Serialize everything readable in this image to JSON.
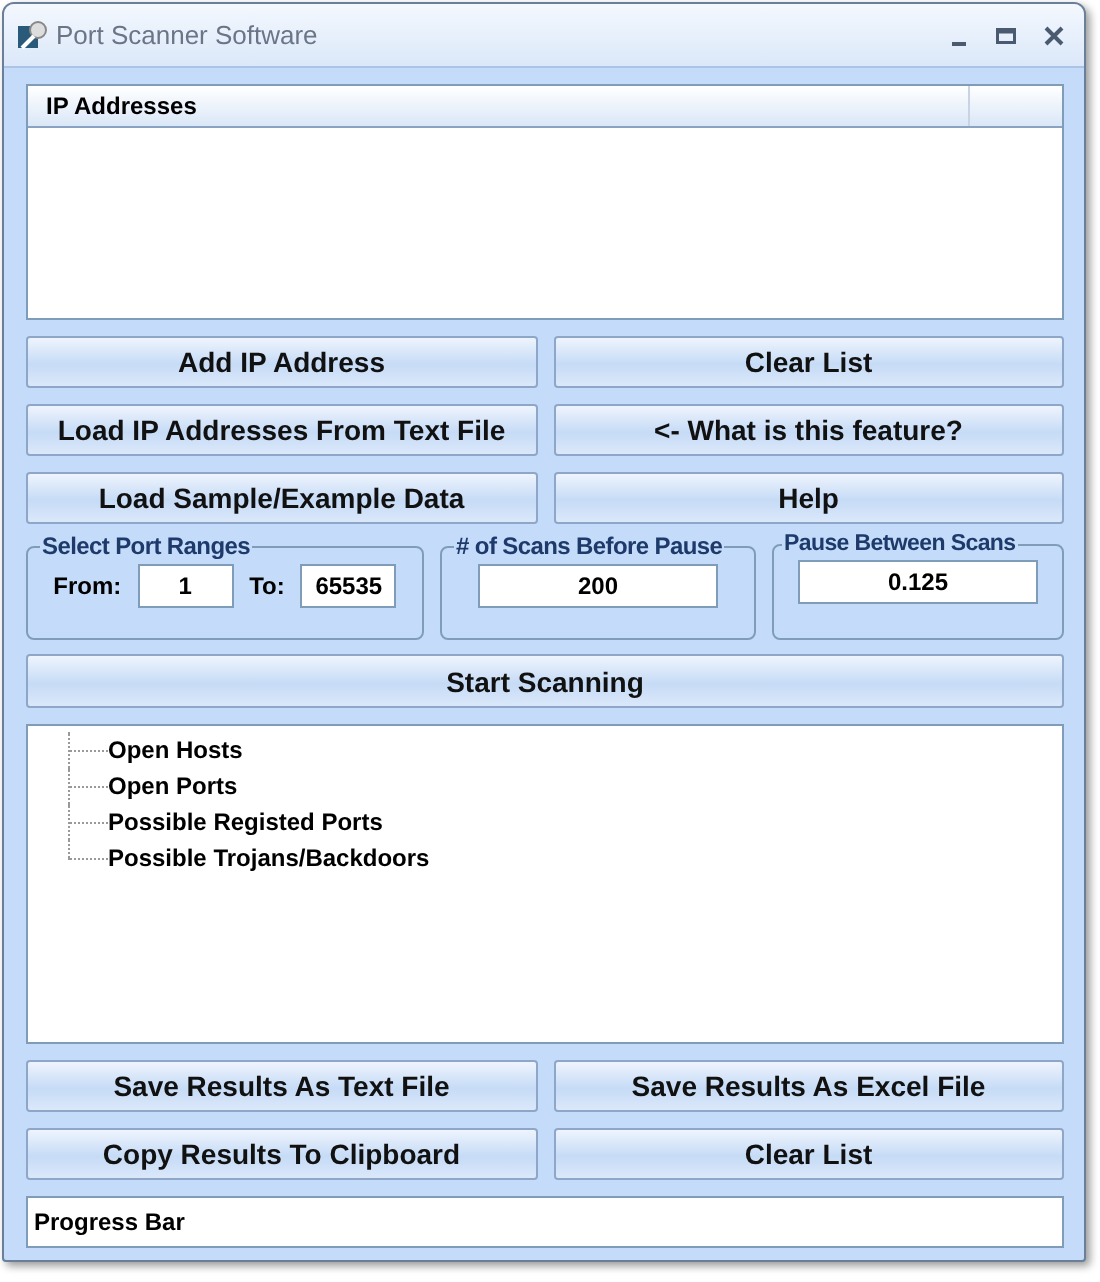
{
  "window": {
    "title": "Port Scanner Software"
  },
  "ip_list": {
    "columns": [
      "IP Addresses"
    ]
  },
  "top_buttons": [
    "Add IP Address",
    "Clear List",
    "Load IP Addresses From Text File",
    "<- What is this feature?",
    "Load Sample/Example Data",
    "Help"
  ],
  "port_ranges": {
    "title": "Select Port Ranges",
    "from_label": "From:",
    "from_value": "1",
    "to_label": "To:",
    "to_value": "65535"
  },
  "scans_before_pause": {
    "title": "# of Scans Before Pause",
    "value": "200"
  },
  "pause_between_scans": {
    "title": "Pause Between Scans",
    "value": "0.125"
  },
  "start_button": "Start Scanning",
  "results_tree": {
    "items": [
      {
        "label": "Open Hosts"
      },
      {
        "label": "Open Ports"
      },
      {
        "label": "Possible Registed Ports"
      },
      {
        "label": "Possible Trojans/Backdoors"
      }
    ]
  },
  "bottom_buttons": [
    "Save Results As Text File",
    "Save Results As Excel File",
    "Copy Results To Clipboard",
    "Clear List"
  ],
  "progress_bar": {
    "text": "Progress Bar"
  }
}
